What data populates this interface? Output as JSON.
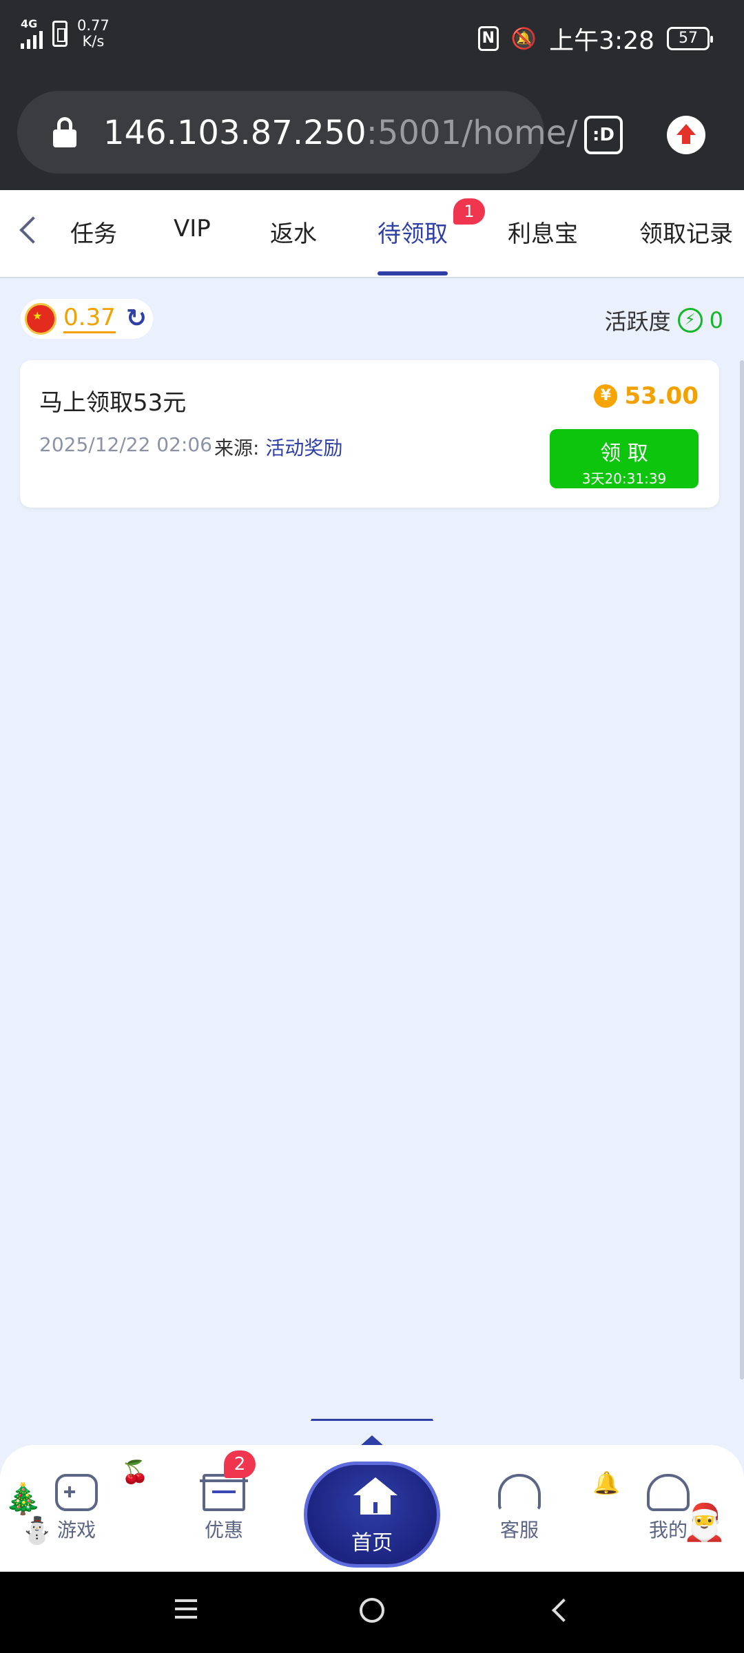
{
  "status_bar": {
    "signal_label": "4G",
    "speed_value": "0.77",
    "speed_unit": "K/s",
    "time": "上午3:28",
    "battery": "57"
  },
  "browser": {
    "url_host": "146.103.87.250",
    "url_rest": ":5001/home/",
    "tab_switcher_label": ":D"
  },
  "tabs": {
    "items": [
      {
        "label": "任务"
      },
      {
        "label": "VIP"
      },
      {
        "label": "返水"
      },
      {
        "label": "待领取",
        "active": true,
        "badge": "1"
      },
      {
        "label": "利息宝"
      },
      {
        "label": "领取记录"
      }
    ]
  },
  "summary": {
    "balance": "0.37",
    "activity_label": "活跃度",
    "activity_value": "0"
  },
  "reward_card": {
    "title": "马上领取53元",
    "amount": "53.00",
    "currency_symbol": "¥",
    "date": "2025/12/22 02:06",
    "source_label": "来源:",
    "source_value": "活动奖励",
    "claim_label": "领 取",
    "countdown": "3天20:31:39"
  },
  "bottom_nav": {
    "games": "游戏",
    "offers": "优惠",
    "offers_badge": "2",
    "home": "首页",
    "support": "客服",
    "mine": "我的"
  },
  "colors": {
    "accent": "#2f3fa8",
    "amount": "#f2a100",
    "claim_button": "#0ec50e",
    "badge": "#f0354e",
    "background": "#eaf1fd"
  },
  "icons": {
    "lock": "lock-icon",
    "refresh": "refresh-icon",
    "bolt": "bolt-icon",
    "yen": "yen-coin-icon"
  }
}
